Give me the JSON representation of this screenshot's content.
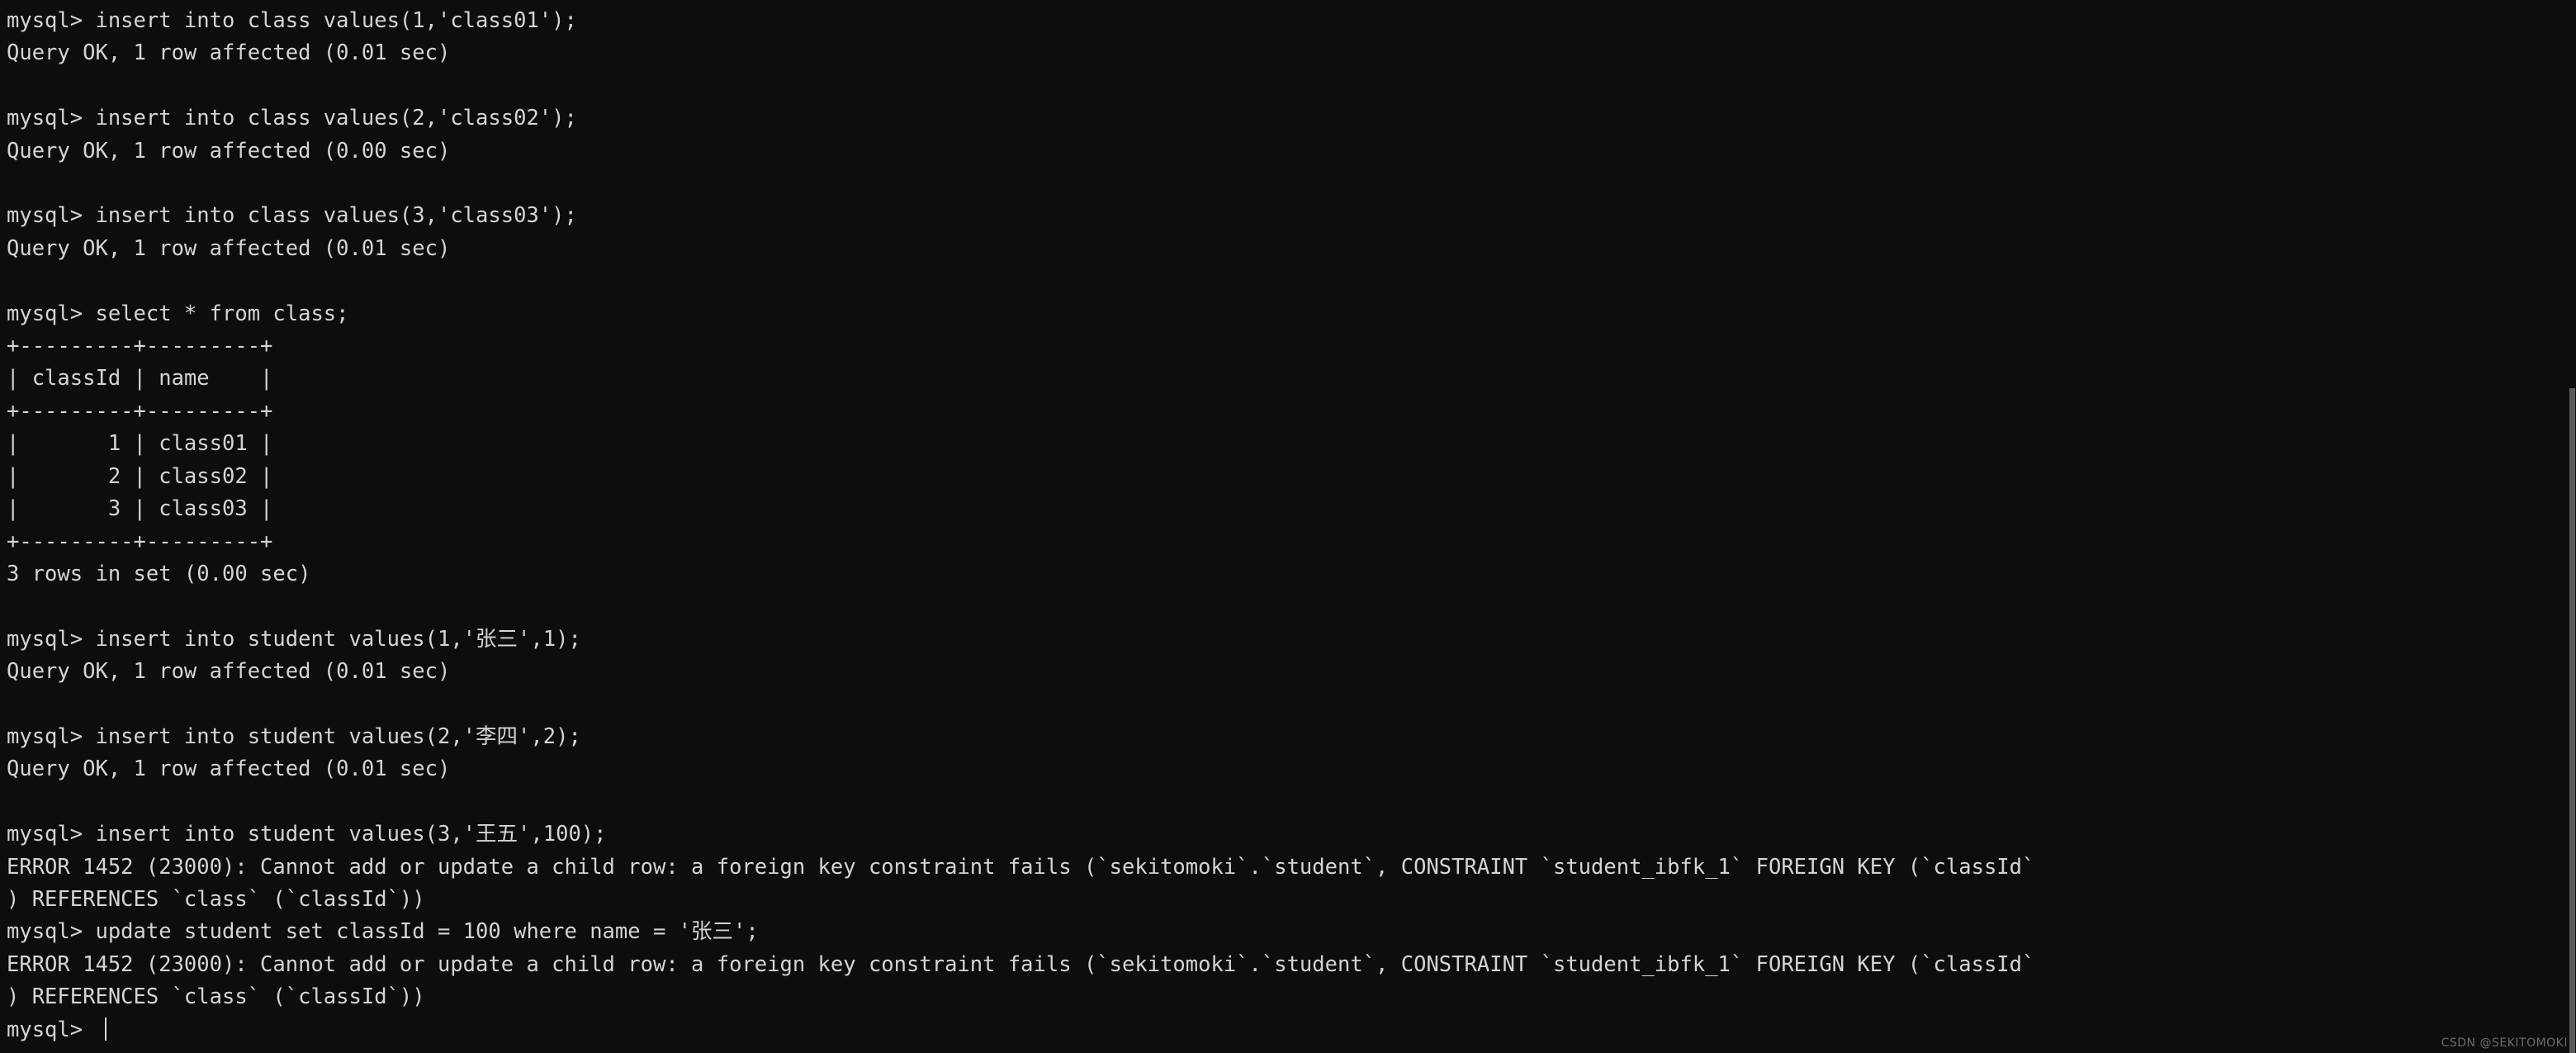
{
  "terminal": {
    "prompt": "mysql>",
    "background_color": "#0d0d0d",
    "text_color": "#d4d4d4",
    "lines": [
      "mysql> insert into class values(1,'class01');",
      "Query OK, 1 row affected (0.01 sec)",
      "",
      "mysql> insert into class values(2,'class02');",
      "Query OK, 1 row affected (0.00 sec)",
      "",
      "mysql> insert into class values(3,'class03');",
      "Query OK, 1 row affected (0.01 sec)",
      "",
      "mysql> select * from class;",
      "+---------+---------+",
      "| classId | name    |",
      "+---------+---------+",
      "|       1 | class01 |",
      "|       2 | class02 |",
      "|       3 | class03 |",
      "+---------+---------+",
      "3 rows in set (0.00 sec)",
      "",
      "mysql> insert into student values(1,'张三',1);",
      "Query OK, 1 row affected (0.01 sec)",
      "",
      "mysql> insert into student values(2,'李四',2);",
      "Query OK, 1 row affected (0.01 sec)",
      "",
      "mysql> insert into student values(3,'王五',100);",
      "ERROR 1452 (23000): Cannot add or update a child row: a foreign key constraint fails (`sekitomoki`.`student`, CONSTRAINT `student_ibfk_1` FOREIGN KEY (`classId`",
      ") REFERENCES `class` (`classId`))",
      "mysql> update student set classId = 100 where name = '张三';",
      "ERROR 1452 (23000): Cannot add or update a child row: a foreign key constraint fails (`sekitomoki`.`student`, CONSTRAINT `student_ibfk_1` FOREIGN KEY (`classId`",
      ") REFERENCES `class` (`classId`))",
      "mysql> "
    ],
    "result_table": {
      "columns": [
        "classId",
        "name"
      ],
      "rows": [
        [
          "1",
          "class01"
        ],
        [
          "2",
          "class02"
        ],
        [
          "3",
          "class03"
        ]
      ],
      "row_count_text": "3 rows in set (0.00 sec)"
    },
    "errors": [
      {
        "code": "ERROR 1452 (23000)",
        "message": "Cannot add or update a child row: a foreign key constraint fails",
        "database": "sekitomoki",
        "table": "student",
        "constraint": "student_ibfk_1",
        "foreign_key": "classId",
        "references_table": "class",
        "references_column": "classId"
      },
      {
        "code": "ERROR 1452 (23000)",
        "message": "Cannot add or update a child row: a foreign key constraint fails",
        "database": "sekitomoki",
        "table": "student",
        "constraint": "student_ibfk_1",
        "foreign_key": "classId",
        "references_table": "class",
        "references_column": "classId"
      }
    ]
  },
  "watermark": {
    "text": "CSDN @SEKITOMOKI"
  }
}
